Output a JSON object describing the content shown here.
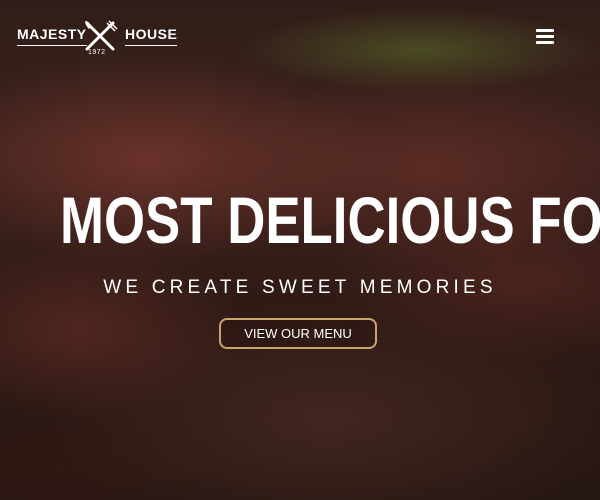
{
  "header": {
    "logo": {
      "left_word": "MAJESTY",
      "right_word": "HOUSE",
      "year": "1972",
      "mark_icon": "crossed-fork-knife-icon"
    },
    "menu_icon": "hamburger-menu-icon"
  },
  "hero": {
    "headline": "MOST DELICIOUS FOOD",
    "subheadline": "WE CREATE SWEET MEMORIES",
    "cta_label": "VIEW OUR MENU"
  },
  "colors": {
    "cta_border": "#c9a46d",
    "text": "#ffffff"
  }
}
